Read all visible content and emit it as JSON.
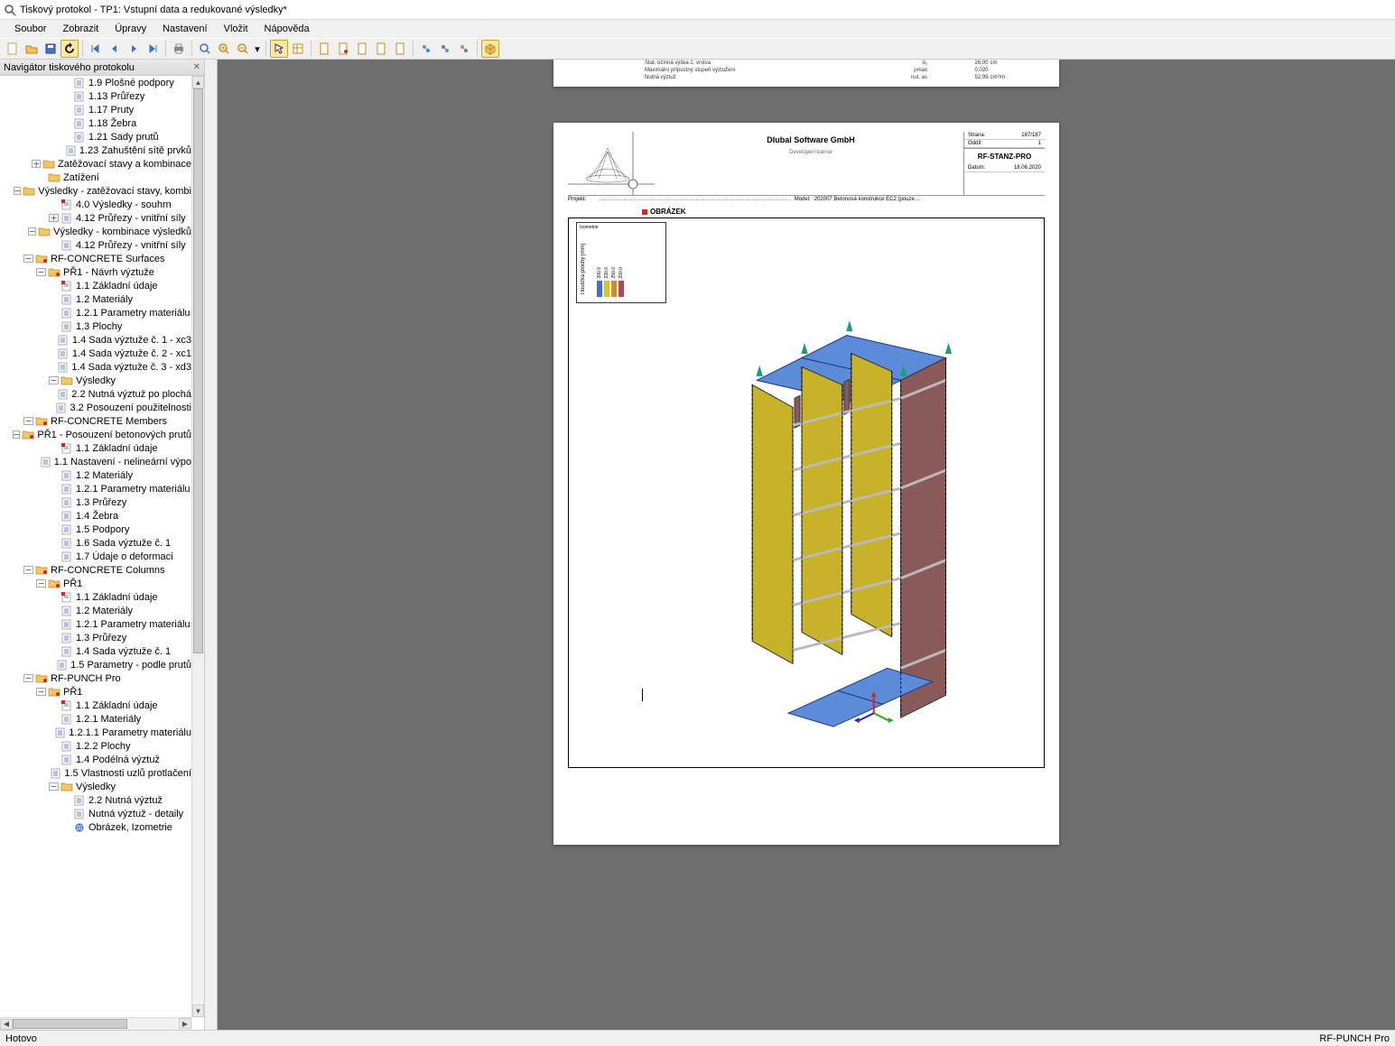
{
  "window_title": "Tiskový protokol - TP1: Vstupní data a redukované výsledky*",
  "menu": [
    "Soubor",
    "Zobrazit",
    "Úpravy",
    "Nastavení",
    "Vložit",
    "Nápověda"
  ],
  "nav_title": "Navigátor tiskového protokolu",
  "tree": [
    {
      "d": 4,
      "i": "p",
      "t": "1.9 Plošné podpory"
    },
    {
      "d": 4,
      "i": "p",
      "t": "1.13 Průřezy"
    },
    {
      "d": 4,
      "i": "p",
      "t": "1.17 Pruty"
    },
    {
      "d": 4,
      "i": "p",
      "t": "1.18 Žebra"
    },
    {
      "d": 4,
      "i": "p",
      "t": "1.21 Sady prutů"
    },
    {
      "d": 4,
      "i": "p",
      "t": "1.23 Zahuštění sítě prvků"
    },
    {
      "d": 2,
      "e": "+",
      "i": "f",
      "t": "Zatěžovací stavy a kombinace"
    },
    {
      "d": 2,
      "e": "b",
      "i": "f",
      "t": "Zatížení"
    },
    {
      "d": 2,
      "e": "-",
      "i": "f",
      "t": "Výsledky - zatěžovací stavy, kombi"
    },
    {
      "d": 3,
      "i": "pr",
      "t": "4.0 Výsledky - souhrn"
    },
    {
      "d": 3,
      "e": "+",
      "i": "p",
      "t": "4.12 Průřezy - vnitřní síly"
    },
    {
      "d": 2,
      "e": "-",
      "i": "f",
      "t": "Výsledky - kombinace výsledků"
    },
    {
      "d": 3,
      "i": "p",
      "t": "4.12 Průřezy - vnitřní síly"
    },
    {
      "d": 1,
      "e": "-",
      "i": "fr",
      "t": "RF-CONCRETE Surfaces"
    },
    {
      "d": 2,
      "e": "-",
      "i": "fr",
      "t": "PŘ1 - Návrh výztuže"
    },
    {
      "d": 3,
      "i": "pr",
      "t": "1.1 Základní údaje"
    },
    {
      "d": 3,
      "i": "p",
      "t": "1.2 Materiály"
    },
    {
      "d": 3,
      "i": "p",
      "t": "1.2.1 Parametry materiálu"
    },
    {
      "d": 3,
      "i": "p",
      "t": "1.3 Plochy"
    },
    {
      "d": 3,
      "i": "p",
      "t": "1.4 Sada výztuže č. 1 - xc3"
    },
    {
      "d": 3,
      "i": "p",
      "t": "1.4 Sada výztuže č. 2 - xc1"
    },
    {
      "d": 3,
      "i": "p",
      "t": "1.4 Sada výztuže č. 3 - xd3"
    },
    {
      "d": 3,
      "e": "-",
      "i": "f",
      "t": "Výsledky"
    },
    {
      "d": 4,
      "i": "p",
      "t": "2.2 Nutná výztuž po plochá"
    },
    {
      "d": 4,
      "i": "p",
      "t": "3.2 Posouzení použitelnosti"
    },
    {
      "d": 1,
      "e": "-",
      "i": "fr",
      "t": "RF-CONCRETE Members"
    },
    {
      "d": 2,
      "e": "-",
      "i": "fr",
      "t": "PŘ1 - Posouzení betonových prutů"
    },
    {
      "d": 3,
      "i": "pr",
      "t": "1.1 Základní údaje"
    },
    {
      "d": 3,
      "i": "p",
      "t": "1.1 Nastavení - nelineární výpo"
    },
    {
      "d": 3,
      "i": "p",
      "t": "1.2 Materiály"
    },
    {
      "d": 3,
      "i": "p",
      "t": "1.2.1 Parametry materiálu"
    },
    {
      "d": 3,
      "i": "p",
      "t": "1.3 Průřezy"
    },
    {
      "d": 3,
      "i": "p",
      "t": "1.4 Žebra"
    },
    {
      "d": 3,
      "i": "p",
      "t": "1.5 Podpory"
    },
    {
      "d": 3,
      "i": "p",
      "t": "1.6 Sada výztuže č. 1"
    },
    {
      "d": 3,
      "i": "p",
      "t": "1.7 Údaje o deformaci"
    },
    {
      "d": 1,
      "e": "-",
      "i": "fr",
      "t": "RF-CONCRETE Columns"
    },
    {
      "d": 2,
      "e": "-",
      "i": "fr",
      "t": "PŘ1"
    },
    {
      "d": 3,
      "i": "pr",
      "t": "1.1 Základní údaje"
    },
    {
      "d": 3,
      "i": "p",
      "t": "1.2 Materiály"
    },
    {
      "d": 3,
      "i": "p",
      "t": "1.2.1 Parametry materiálu"
    },
    {
      "d": 3,
      "i": "p",
      "t": "1.3 Průřezy"
    },
    {
      "d": 3,
      "i": "p",
      "t": "1.4 Sada výztuže č. 1"
    },
    {
      "d": 3,
      "i": "p",
      "t": "1.5 Parametry - podle prutů"
    },
    {
      "d": 1,
      "e": "-",
      "i": "fr",
      "t": "RF-PUNCH Pro"
    },
    {
      "d": 2,
      "e": "-",
      "i": "fr",
      "t": "PŘ1"
    },
    {
      "d": 3,
      "i": "pr",
      "t": "1.1 Základní údaje"
    },
    {
      "d": 3,
      "i": "p",
      "t": "1.2.1 Materiály"
    },
    {
      "d": 3,
      "i": "p",
      "t": "1.2.1.1 Parametry materiálu"
    },
    {
      "d": 3,
      "i": "p",
      "t": "1.2.2 Plochy"
    },
    {
      "d": 3,
      "i": "p",
      "t": "1.4 Podélná výztuž"
    },
    {
      "d": 3,
      "i": "p",
      "t": "1.5 Vlastnosti uzlů protlačení"
    },
    {
      "d": 3,
      "e": "-",
      "i": "f",
      "t": "Výsledky"
    },
    {
      "d": 4,
      "i": "p",
      "t": "2.2 Nutná výztuž"
    },
    {
      "d": 4,
      "i": "p",
      "t": "Nutná výztuž - detaily"
    },
    {
      "d": 4,
      "i": "g",
      "t": "Obrázek, Izometrie"
    }
  ],
  "prev_page_rows": [
    {
      "l": "Stat. účinná výška 2. vrstva",
      "s": "d₂",
      "v": "26,00",
      "u": "cm"
    },
    {
      "l": "Maximální přípustný stupeň vyztužení",
      "s": "ρmax",
      "v": "0,020",
      "u": ""
    },
    {
      "l": "Nutná výztuž",
      "s": "nut. as",
      "v": "52,99",
      "u": "cm²/m"
    }
  ],
  "page": {
    "company": "Dlubal Software GmbH",
    "subtitle": "Developer license",
    "info_page_lbl": "Strana:",
    "info_page_val": "187/187",
    "info_sheet_lbl": "Oddíl:",
    "info_sheet_val": "1",
    "module": "RF-STANZ-PRO",
    "projekt_lbl": "Projekt:",
    "model_lbl": "Model:",
    "model_val": "202007 Betonová konstrukce EC2 (pouze ...",
    "date_lbl": "Datum:",
    "date_val": "18.06.2020",
    "section_title": "OBRÁZEK",
    "legend_title": "Izometrie",
    "legend_axis": "Tloušťka plochy [mm]",
    "legend_vals": [
      "200.0",
      "230.0",
      "250.0",
      "200.0"
    ]
  },
  "status_left": "Hotovo",
  "status_right": "RF-PUNCH Pro"
}
